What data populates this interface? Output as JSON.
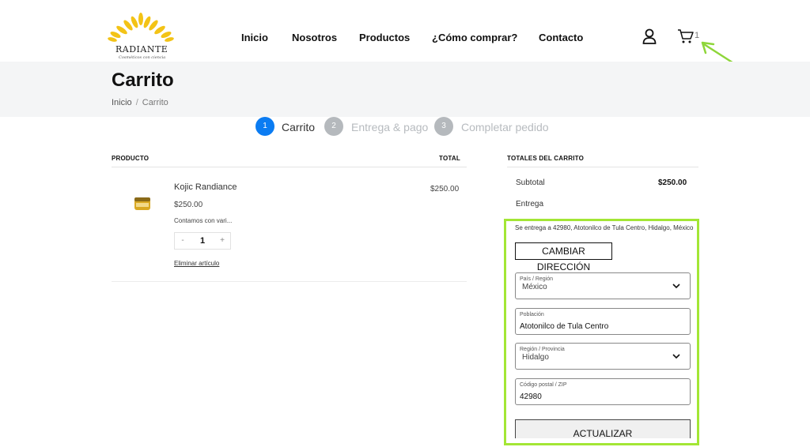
{
  "header": {
    "logo": {
      "title": "RADIANTE",
      "subtitle": "Cosméticos con ciencia"
    },
    "nav": [
      "Inicio",
      "Nosotros",
      "Productos",
      "¿Cómo comprar?",
      "Contacto"
    ],
    "cart_count": "1"
  },
  "page": {
    "title": "Carrito",
    "breadcrumb": {
      "home": "Inicio",
      "separator": "/",
      "current": "Carrito"
    }
  },
  "steps": [
    {
      "number": "1",
      "label": "Carrito",
      "active": true
    },
    {
      "number": "2",
      "label": "Entrega & pago",
      "active": false
    },
    {
      "number": "3",
      "label": "Completar pedido",
      "active": false
    }
  ],
  "cart": {
    "headers": {
      "product": "PRODUCTO",
      "total": "TOTAL"
    },
    "items": [
      {
        "name": "Kojic Randiance",
        "price": "$250.00",
        "description": "Contamos con vari...",
        "quantity": "1",
        "minus": "-",
        "plus": "+",
        "remove": "Eliminar artículo",
        "total": "$250.00"
      }
    ]
  },
  "totals": {
    "heading": "TOTALES DEL CARRITO",
    "subtotal_label": "Subtotal",
    "subtotal_value": "$250.00",
    "shipping_label": "Entrega",
    "shipping_text": "Se entrega a 42980, Atotonilco de Tula Centro, Hidalgo, México",
    "change_address": "CAMBIAR DIRECCIÓN",
    "fields": {
      "country": {
        "label": "País / Región",
        "value": "México"
      },
      "city": {
        "label": "Población",
        "value": "Atotonilco de Tula Centro"
      },
      "region": {
        "label": "Región / Provincia",
        "value": "Hidalgo"
      },
      "zip": {
        "label": "Código postal / ZIP",
        "value": "42980"
      }
    },
    "update": "ACTUALIZAR"
  },
  "colors": {
    "accent": "#0b7cf2",
    "inactive_step": "#b5b9bd",
    "highlight": "#a3e635",
    "arrow": "#8ed63a",
    "band": "#f4f5f6",
    "logo_gold": "#f3c316"
  }
}
